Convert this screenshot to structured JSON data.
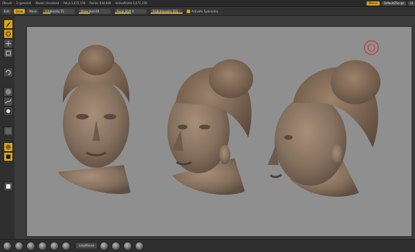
{
  "menubar": {
    "items": [
      "ZBrush",
      "3 (general)",
      "Model: Unnamed",
      "Polys:1,672,150",
      "Points: 834,608",
      "ActivePoints:1,672,150"
    ],
    "right_pills": [
      {
        "label": "Menus",
        "active": true
      },
      {
        "label": "DefaultZScript",
        "active": false
      },
      {
        "label": "Ui",
        "active": false
      }
    ]
  },
  "toolbar": {
    "buttons": [
      {
        "label": "Edit",
        "active": false
      },
      {
        "label": "Draw",
        "active": true
      },
      {
        "label": "Move",
        "active": false
      }
    ],
    "sliders": [
      {
        "label": "Z Intensity 25",
        "level": 0.25
      },
      {
        "label": "Draw Size 64",
        "level": 0.35
      },
      {
        "label": "Focal Shift 0",
        "level": 0.5
      },
      {
        "label": "RGB Intensity 100",
        "level": 1.0
      }
    ],
    "toggle": {
      "label": "Activate Symmetry"
    }
  },
  "bottombar": {
    "label": "LazyMouse"
  },
  "colors": {
    "accent": "#d8a313",
    "viewport": "#8f8f8f",
    "clay": "#8a735f",
    "cursor_ring": "#c0392b"
  }
}
